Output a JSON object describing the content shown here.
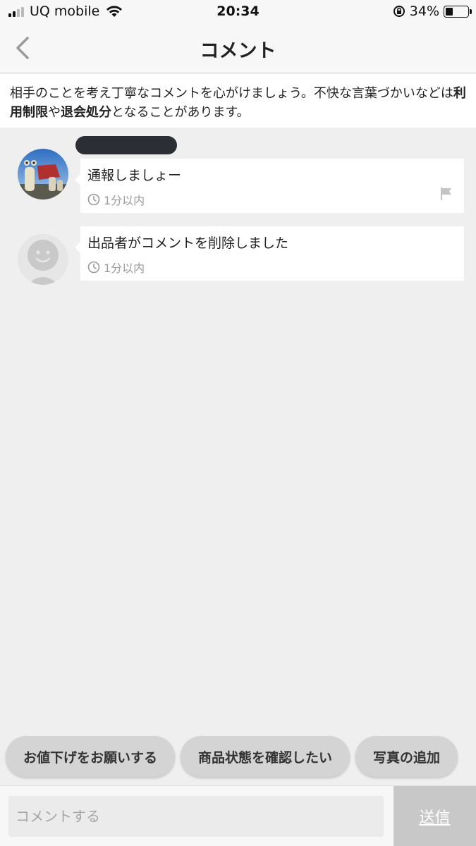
{
  "status_bar": {
    "carrier": "UQ mobile",
    "time": "20:34",
    "battery": "34%",
    "battery_level": 0.34
  },
  "nav": {
    "title": "コメント"
  },
  "notice": {
    "text_1": "相手のことを考え丁寧なコメントを心がけましょう。不快な言葉づかいなどは",
    "bold_1": "利用制限",
    "text_2": "や",
    "bold_2": "退会処分",
    "text_3": "となることがあります。"
  },
  "comments": [
    {
      "text": "通報しましょー",
      "time": "1分以内",
      "avatar": "photo-avatar",
      "has_flag": true
    },
    {
      "text": "出品者がコメントを削除しました",
      "time": "1分以内",
      "avatar": "default-avatar",
      "has_flag": false
    }
  ],
  "quick_replies": [
    "お値下げをお願いする",
    "商品状態を確認したい",
    "写真の追加"
  ],
  "input": {
    "placeholder": "コメントする",
    "value": ""
  },
  "send_label": "送信"
}
